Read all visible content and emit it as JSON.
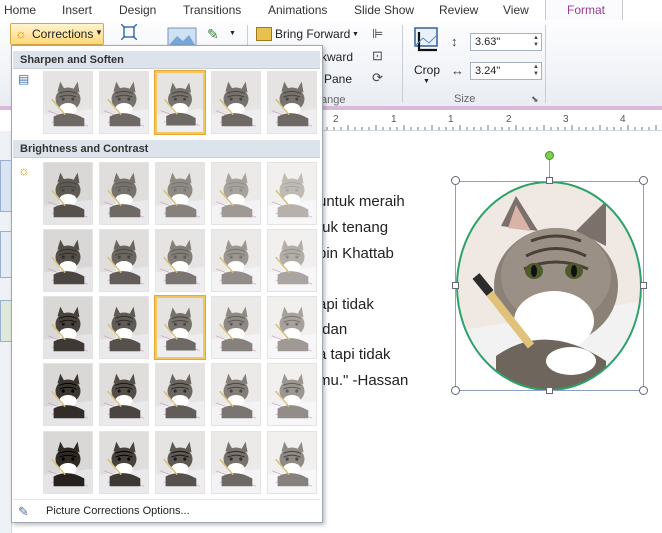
{
  "tabs": [
    {
      "label": "Home"
    },
    {
      "label": "Insert"
    },
    {
      "label": "Design"
    },
    {
      "label": "Transitions"
    },
    {
      "label": "Animations"
    },
    {
      "label": "Slide Show"
    },
    {
      "label": "Review"
    },
    {
      "label": "View"
    },
    {
      "label": "Format",
      "active": true
    }
  ],
  "ribbon": {
    "corrections_label": "Corrections",
    "bring_forward_label": "Bring Forward",
    "send_backward_partial": "kward",
    "selection_pane_partial": "Pane",
    "arrange_partial": "ange",
    "crop_label": "Crop",
    "size_group_label": "Size",
    "height_value": "3.63\"",
    "width_value": "3.24\""
  },
  "dropdown": {
    "section1_title": "Sharpen and Soften",
    "section2_title": "Brightness and Contrast",
    "footer_label": "Picture Corrections Options...",
    "sharpen_selected_index": 2,
    "brightness_selected": [
      2,
      2
    ]
  },
  "slide_text": [
    "untuk meraih",
    "tuk tenang",
    "bin Khattab",
    "",
    "api tidak",
    ",dan",
    "a tapi tidak",
    "mu.\" -Hassan"
  ],
  "ruler_labels": [
    "2",
    "1",
    "1",
    "2",
    "3",
    "4"
  ],
  "colors": {
    "accent": "#9b3b9c",
    "selection": "#f1c860",
    "frame": "#2ea16b",
    "rotate_handle": "#7cd14e"
  }
}
